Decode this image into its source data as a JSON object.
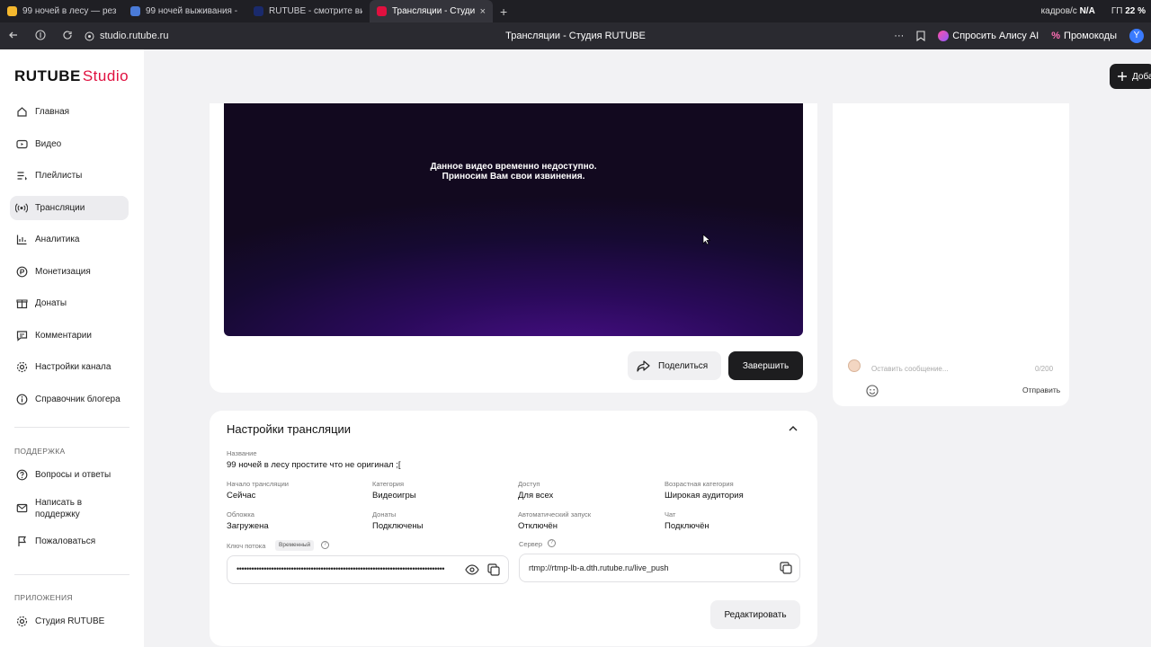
{
  "browser": {
    "tabs": [
      {
        "label": "99 ночей в лесу — резуль",
        "color": "#f5b82e"
      },
      {
        "label": "99 ночей выживания - ле",
        "color": "#4a7bd8"
      },
      {
        "label": "RUTUBE - смотрите виде",
        "color": "#1a2a6c"
      },
      {
        "label": "Трансляции - Студия R",
        "color": "#e0103f"
      }
    ],
    "new_tab": "+",
    "close_glyph": "×",
    "stats": {
      "fps_label": "кадров/с",
      "fps_value": "N/A",
      "gpu_label": "ГП",
      "gpu_value": "22 %"
    },
    "url": "studio.rutube.ru",
    "page_title": "Трансляции - Студия RUTUBE",
    "alice_label": "Спросить Алису AI",
    "promo_label": "Промокоды",
    "menu_dots": "···"
  },
  "app": {
    "logo_main": "RUTUBE",
    "logo_studio": "Studio",
    "add_button": "Доба",
    "nav": [
      {
        "label": "Главная",
        "icon": "home-icon"
      },
      {
        "label": "Видео",
        "icon": "video-icon"
      },
      {
        "label": "Плейлисты",
        "icon": "playlist-icon"
      },
      {
        "label": "Трансляции",
        "icon": "broadcast-icon",
        "active": true
      },
      {
        "label": "Аналитика",
        "icon": "analytics-icon"
      },
      {
        "label": "Монетизация",
        "icon": "monetization-icon"
      },
      {
        "label": "Донаты",
        "icon": "donate-icon"
      },
      {
        "label": "Комментарии",
        "icon": "comments-icon"
      },
      {
        "label": "Настройки канала",
        "icon": "settings-icon"
      },
      {
        "label": "Справочник блогера",
        "icon": "info-icon"
      }
    ],
    "support_title": "ПОДДЕРЖКА",
    "support": [
      {
        "label": "Вопросы и ответы",
        "icon": "help-icon"
      },
      {
        "label": "Написать в поддержку",
        "icon": "mail-icon"
      },
      {
        "label": "Пожаловаться",
        "icon": "flag-icon"
      }
    ],
    "apps_title": "ПРИЛОЖЕНИЯ",
    "apps": [
      {
        "label": "Студия RUTUBE",
        "icon": "settings-icon"
      }
    ]
  },
  "player": {
    "message_line1": "Данное видео временно недоступно.",
    "message_line2": "Приносим Вам свои извинения.",
    "share_label": "Поделиться",
    "finish_label": "Завершить"
  },
  "chat": {
    "placeholder": "Оставить сообщение...",
    "counter": "0/200",
    "send_label": "Отправить"
  },
  "settings": {
    "title": "Настройки трансляции",
    "name_label": "Название",
    "name_value": "99 ночей в лесу простите что не оригинал ;[",
    "fields": [
      {
        "label": "Начало трансляции",
        "value": "Сейчас"
      },
      {
        "label": "Категория",
        "value": "Видеоигры"
      },
      {
        "label": "Доступ",
        "value": "Для всех"
      },
      {
        "label": "Возрастная категория",
        "value": "Широкая аудитория"
      },
      {
        "label": "Обложка",
        "value": "Загружена"
      },
      {
        "label": "Донаты",
        "value": "Подключены"
      },
      {
        "label": "Автоматический запуск",
        "value": "Отключён"
      },
      {
        "label": "Чат",
        "value": "Подключён"
      }
    ],
    "key_label": "Ключ потока",
    "key_badge": "Временный",
    "key_value": "••••••••••••••••••••••••••••••••••••••••••••••••••••••••••••••••••••••••••••••••••••",
    "server_label": "Сервер",
    "server_value": "rtmp://rtmp-lb-a.dth.rutube.ru/live_push",
    "edit_label": "Редактировать"
  }
}
